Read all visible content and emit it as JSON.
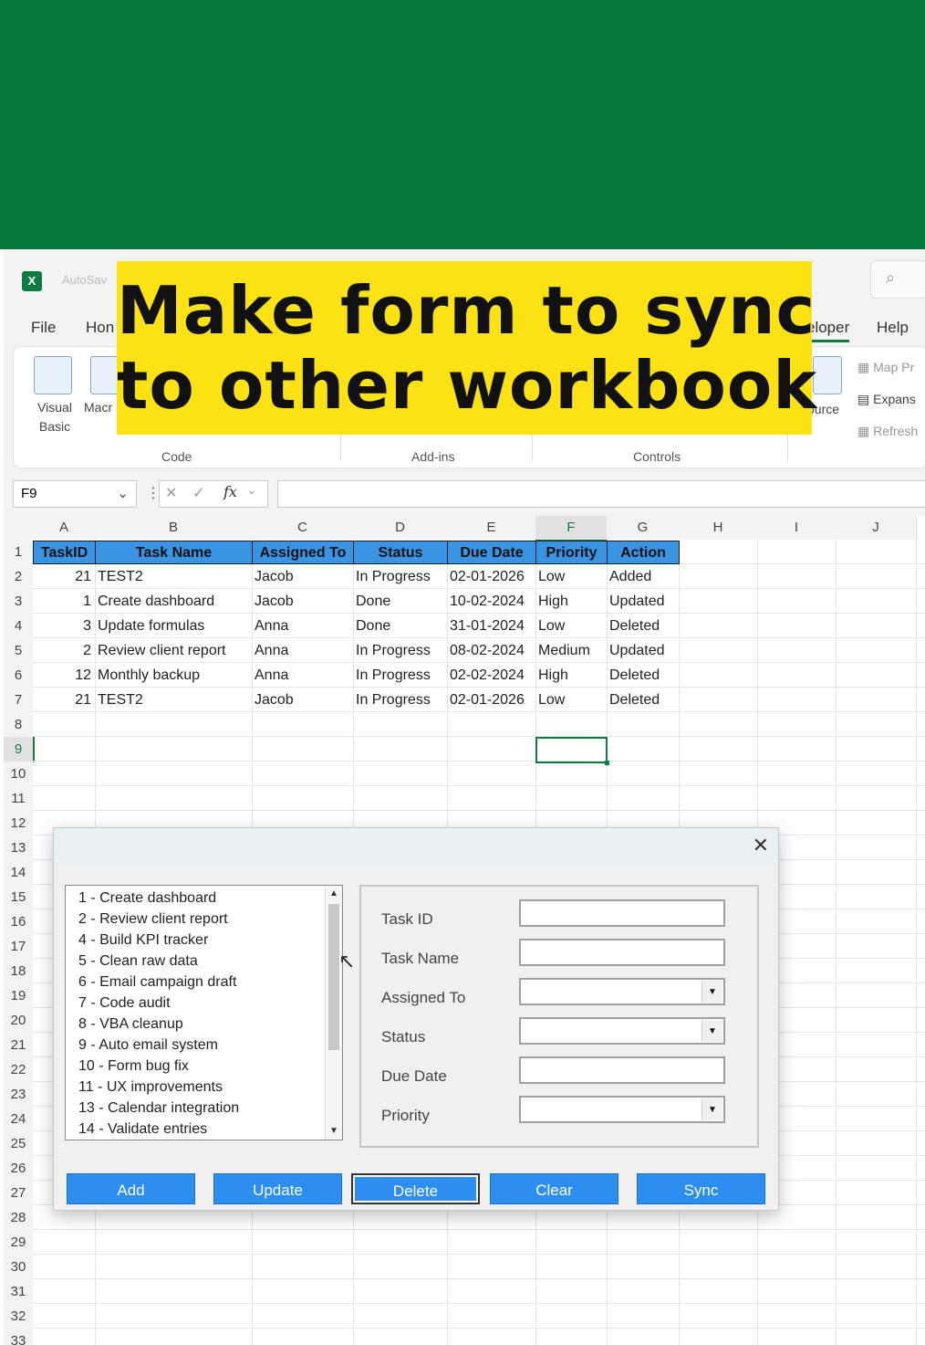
{
  "caption": {
    "line1": "Make form to sync",
    "line2": "to other workbook"
  },
  "titlebar": {
    "app_icon": "X",
    "autosave": "AutoSav"
  },
  "menus": {
    "file": "File",
    "home": "Hon",
    "developer": "eloper",
    "help": "Help"
  },
  "ribbon": {
    "visual_basic": "Visual Basic",
    "macros": "Macr",
    "source": "ource",
    "map": "Map Pr",
    "expansion": "Expans",
    "refresh": "Refresh",
    "groups": {
      "code": "Code",
      "addins": "Add-ins",
      "controls": "Controls"
    }
  },
  "formula_bar": {
    "name_box": "F9",
    "fx": "fx",
    "value": ""
  },
  "columns": [
    "A",
    "B",
    "C",
    "D",
    "E",
    "F",
    "G",
    "H",
    "I",
    "J"
  ],
  "rows": [
    "1",
    "2",
    "3",
    "4",
    "5",
    "6",
    "7",
    "8",
    "9",
    "10",
    "11",
    "12",
    "13",
    "14",
    "15",
    "16",
    "17",
    "18",
    "19",
    "20",
    "21",
    "22",
    "23",
    "24",
    "25",
    "26",
    "27",
    "28",
    "29",
    "30",
    "31",
    "32",
    "33"
  ],
  "table": {
    "headers": [
      "TaskID",
      "Task Name",
      "Assigned To",
      "Status",
      "Due Date",
      "Priority",
      "Action"
    ],
    "rows": [
      [
        "21",
        "TEST2",
        "Jacob",
        "In Progress",
        "02-01-2026",
        "Low",
        "Added"
      ],
      [
        "1",
        "Create dashboard",
        "Jacob",
        "Done",
        "10-02-2024",
        "High",
        "Updated"
      ],
      [
        "3",
        "Update formulas",
        "Anna",
        "Done",
        "31-01-2024",
        "Low",
        "Deleted"
      ],
      [
        "2",
        "Review client report",
        "Anna",
        "In Progress",
        "08-02-2024",
        "Medium",
        "Updated"
      ],
      [
        "12",
        "Monthly backup",
        "Anna",
        "In Progress",
        "02-02-2024",
        "High",
        "Deleted"
      ],
      [
        "21",
        "TEST2",
        "Jacob",
        "In Progress",
        "02-01-2026",
        "Low",
        "Deleted"
      ]
    ]
  },
  "form": {
    "close": "✕",
    "list_items": [
      "1 - Create dashboard",
      "2 - Review client report",
      "4 - Build KPI tracker",
      "5 - Clean raw data",
      "6 - Email campaign draft",
      "7 - Code audit",
      "8 - VBA cleanup",
      "9 - Auto email system",
      "10 - Form bug fix",
      "11 - UX improvements",
      "13 - Calendar integration",
      "14 - Validate entries"
    ],
    "fields": {
      "task_id": {
        "label": "Task ID",
        "value": ""
      },
      "task_name": {
        "label": "Task Name",
        "value": ""
      },
      "assigned_to": {
        "label": "Assigned To",
        "value": ""
      },
      "status": {
        "label": "Status",
        "value": ""
      },
      "due_date": {
        "label": "Due Date",
        "value": ""
      },
      "priority": {
        "label": "Priority",
        "value": ""
      }
    },
    "buttons": {
      "add": "Add",
      "update": "Update",
      "delete": "Delete",
      "clear": "Clear",
      "sync": "Sync"
    }
  },
  "colors": {
    "banner": "#07783a",
    "caption_bg": "#fce214",
    "header_fill": "#3a94e4",
    "button": "#2b8ef0",
    "excel_green": "#107c41"
  }
}
